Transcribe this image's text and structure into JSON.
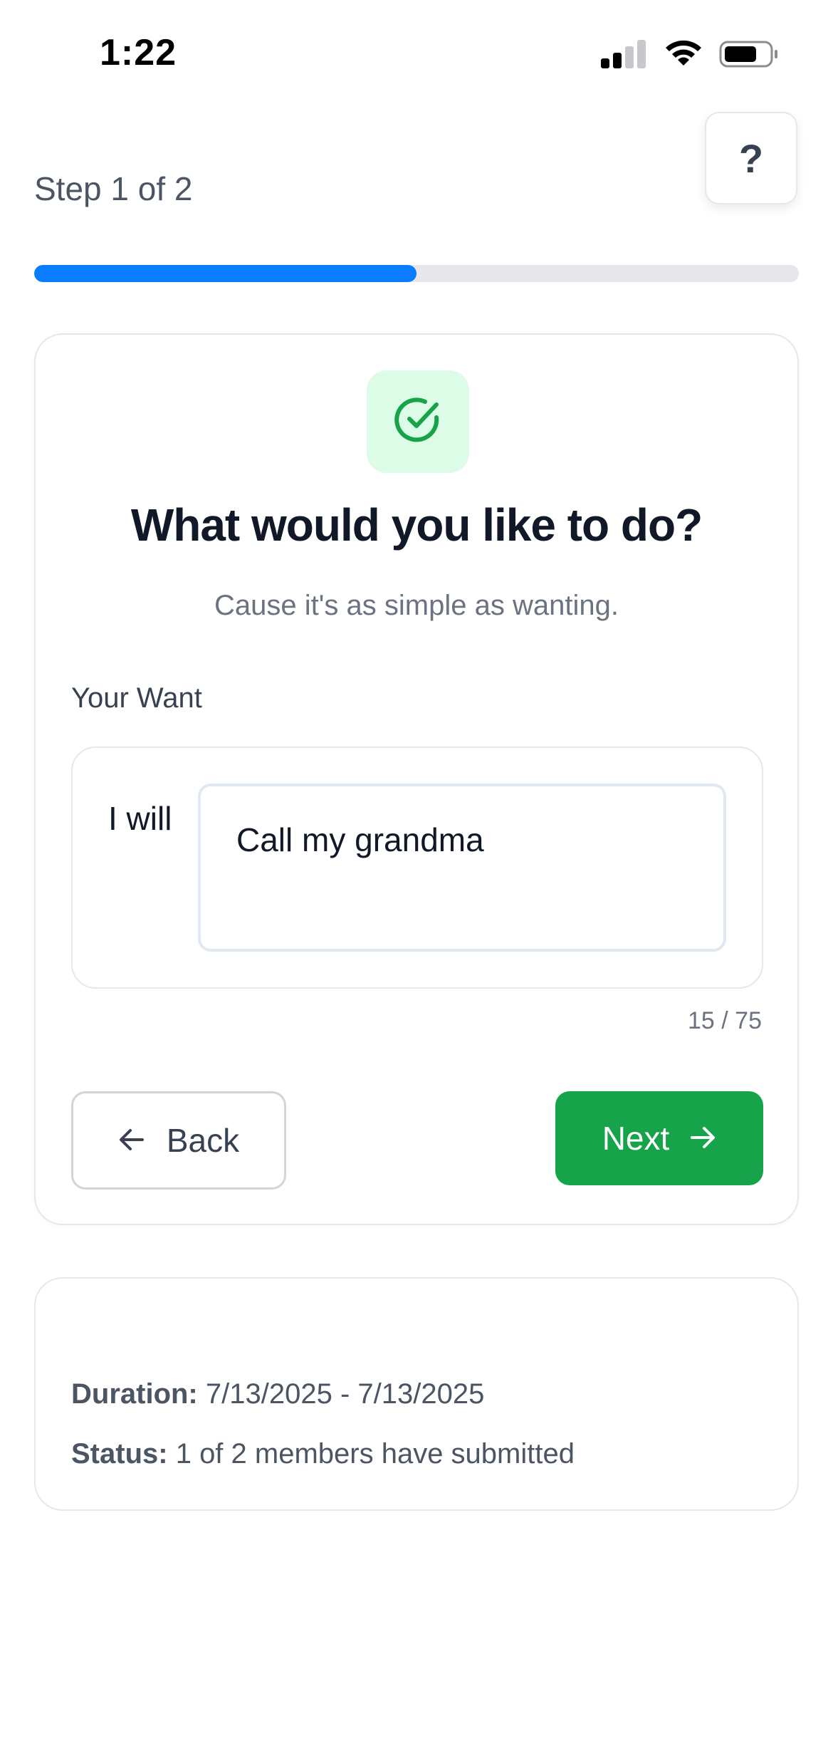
{
  "status_bar": {
    "time": "1:22"
  },
  "help": {
    "label": "?"
  },
  "wizard": {
    "step_label": "Step 1 of 2",
    "progress_fraction": 0.5
  },
  "card": {
    "title": "What would you like to do?",
    "subtitle": "Cause it's as simple as wanting.",
    "field_label": "Your Want",
    "prefix": "I will",
    "input_value": "Call my grandma",
    "char_count": "15 / 75",
    "back_label": "Back",
    "next_label": "Next"
  },
  "info": {
    "duration_label": "Duration:",
    "duration_value": "7/13/2025 - 7/13/2025",
    "status_label": "Status:",
    "status_value": "1 of 2 members have submitted"
  },
  "colors": {
    "accent_blue": "#0a7cff",
    "success_green": "#16a34a",
    "tile_green": "#dcfce7"
  },
  "icons": [
    "signal-icon",
    "wifi-icon",
    "battery-icon",
    "check-circle-icon",
    "arrow-left-icon",
    "arrow-right-icon"
  ]
}
